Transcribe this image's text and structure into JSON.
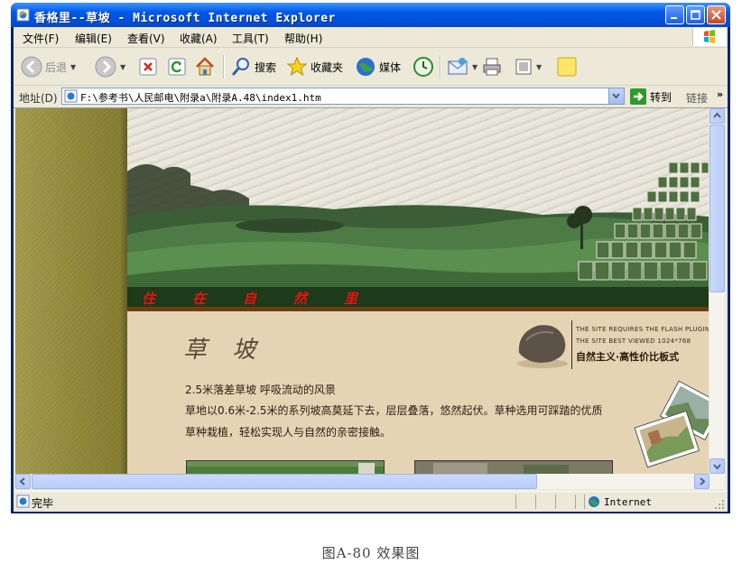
{
  "window": {
    "title": "香格里--草坡 - Microsoft Internet Explorer"
  },
  "menu": [
    "文件(F)",
    "编辑(E)",
    "查看(V)",
    "收藏(A)",
    "工具(T)",
    "帮助(H)"
  ],
  "toolbar": {
    "back": "后退",
    "search": "搜索",
    "favorites": "收藏夹",
    "media": "媒体"
  },
  "address": {
    "label": "地址(D)",
    "url": "F:\\参考书\\人民邮电\\附录a\\附录A.48\\index1.htm",
    "go": "转到",
    "links": "链接",
    "more": "»"
  },
  "page": {
    "slogan": [
      "住",
      "在",
      "自",
      "然",
      "里"
    ],
    "heading": "草 坡",
    "para1": "2.5米落差草坡 呼吸流动的风景",
    "para2": "草地以0.6米-2.5米的系列坡高莫延下去，层层叠落，悠然起伏。草种选用可踩踏的优质",
    "para3": "草种栽植，轻松实现人与自然的亲密接触。",
    "site_line1": "THE SITE REQUIRES THE FLASH PLUGIN",
    "site_line2": "THE SITE BEST VIEWED 1024*768",
    "site_line3": "自然主义·高性价比板式"
  },
  "status": {
    "text": "完毕",
    "zone": "Internet"
  },
  "caption": "图A-80 效果图"
}
